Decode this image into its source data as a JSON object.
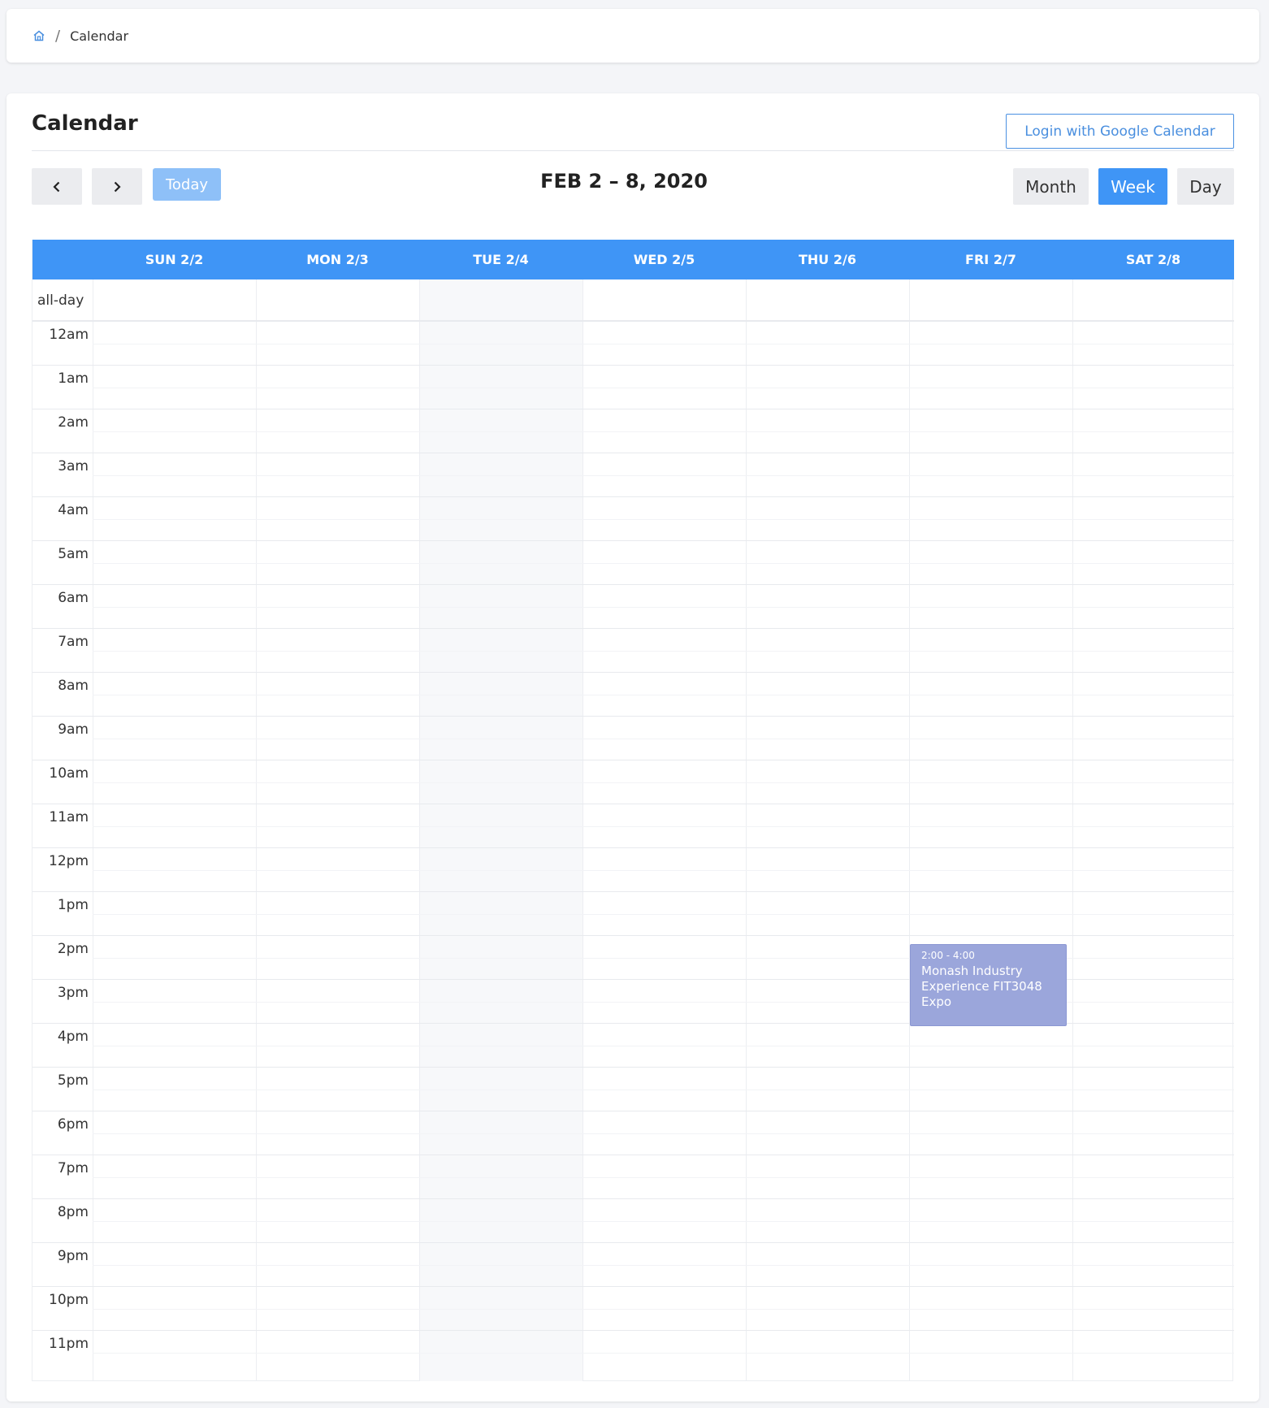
{
  "breadcrumb": {
    "home_icon": "home-icon",
    "separator": "/",
    "current": "Calendar"
  },
  "page": {
    "title": "Calendar",
    "google_button": "Login with Google Calendar"
  },
  "toolbar": {
    "prev_icon": "chevron-left-icon",
    "next_icon": "chevron-right-icon",
    "today_label": "Today",
    "range_title": "FEB 2 – 8, 2020",
    "views": [
      {
        "label": "Month",
        "active": false
      },
      {
        "label": "Week",
        "active": true
      },
      {
        "label": "Day",
        "active": false
      }
    ]
  },
  "calendar": {
    "days": [
      "SUN 2/2",
      "MON 2/3",
      "TUE 2/4",
      "WED 2/5",
      "THU 2/6",
      "FRI 2/7",
      "SAT 2/8"
    ],
    "today_column": "TUE 2/4",
    "allday_label": "all-day",
    "hours": [
      "12am",
      "1am",
      "2am",
      "3am",
      "4am",
      "5am",
      "6am",
      "7am",
      "8am",
      "9am",
      "10am",
      "11am",
      "12pm",
      "1pm",
      "2pm",
      "3pm",
      "4pm",
      "5pm",
      "6pm",
      "7pm",
      "8pm",
      "9pm",
      "10pm",
      "11pm"
    ],
    "events": [
      {
        "day": "FRI 2/7",
        "time": "2:00 - 4:00",
        "title": "Monash Industry Experience FIT3048 Expo",
        "color": "#9ba6db"
      }
    ]
  },
  "colors": {
    "accent": "#3f95f6",
    "today_button": "#8ec0f8",
    "event": "#9ba6db"
  }
}
